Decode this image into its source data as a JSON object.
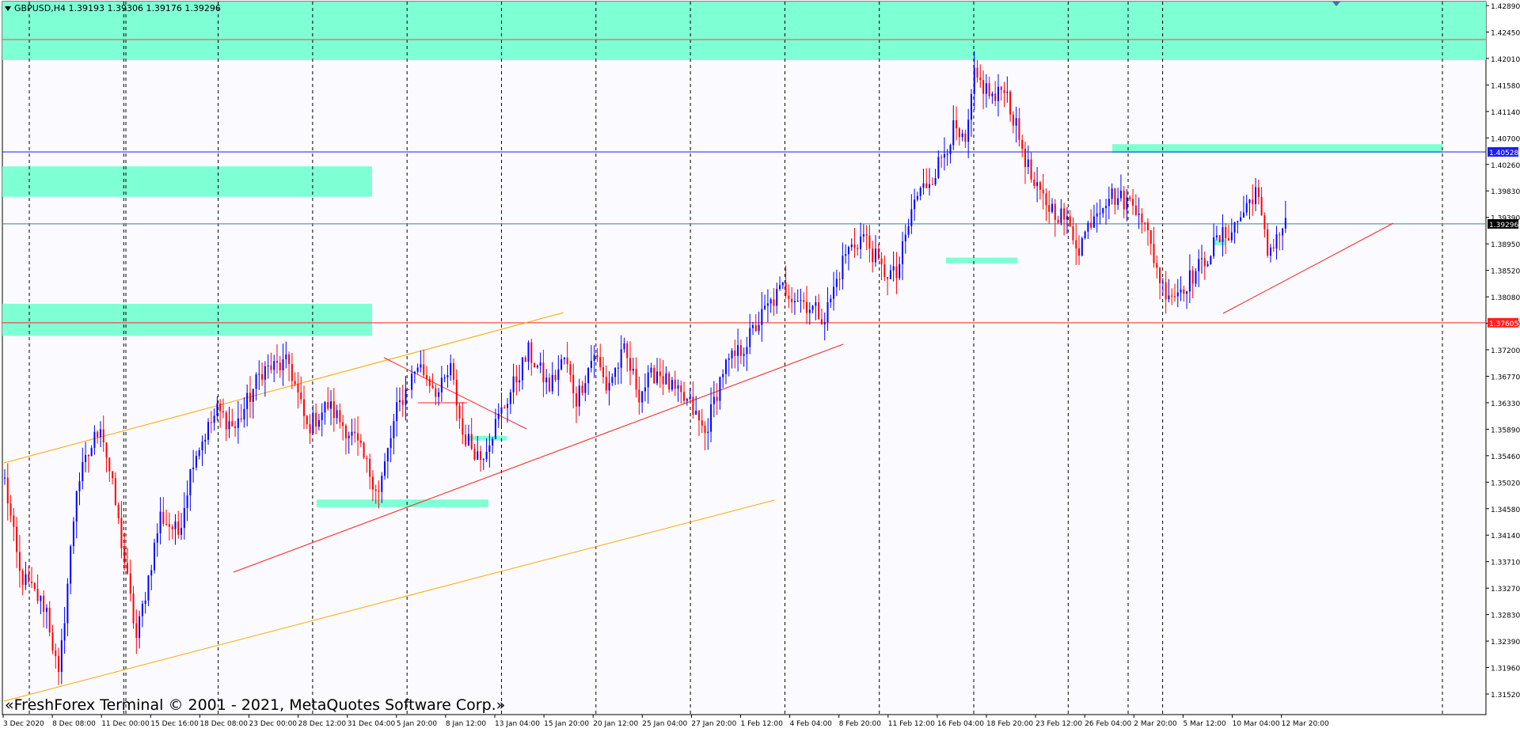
{
  "chart_data": {
    "type": "candlestick",
    "symbol_header": "GBPUSD,H4  1.39193 1.39306 1.39176 1.39296",
    "copyright": "«FreshForex Terminal © 2001 - 2021, MetaQuotes Software Corp.»",
    "ylim": [
      1.309,
      1.431
    ],
    "price_ticks": [
      "1.42890",
      "1.42450",
      "1.42010",
      "1.41580",
      "1.41140",
      "1.40700",
      "1.40260",
      "1.39830",
      "1.39390",
      "1.38950",
      "1.38520",
      "1.38080",
      "1.37640",
      "1.37200",
      "1.36770",
      "1.36330",
      "1.35890",
      "1.35460",
      "1.35020",
      "1.34580",
      "1.34140",
      "1.33710",
      "1.33270",
      "1.32830",
      "1.32390",
      "1.31960",
      "1.31520"
    ],
    "time_labels": [
      "3 Dec 2020",
      "8 Dec 08:00",
      "11 Dec 00:00",
      "15 Dec 16:00",
      "18 Dec 08:00",
      "23 Dec 00:00",
      "28 Dec 12:00",
      "31 Dec 04:00",
      "5 Jan 20:00",
      "8 Jan 12:00",
      "13 Jan 04:00",
      "15 Jan 20:00",
      "20 Jan 12:00",
      "25 Jan 04:00",
      "27 Jan 20:00",
      "1 Feb 12:00",
      "4 Feb 04:00",
      "8 Feb 20:00",
      "11 Feb 12:00",
      "16 Feb 04:00",
      "18 Feb 20:00",
      "23 Feb 12:00",
      "26 Feb 04:00",
      "2 Mar 20:00",
      "5 Mar 12:00",
      "10 Mar 04:00",
      "12 Mar 20:00"
    ],
    "price_tags": [
      {
        "label": "1.40528",
        "price": 1.40528,
        "bg": "#1a1aff",
        "line": "#1a1aff"
      },
      {
        "label": "1.39296",
        "price": 1.39296,
        "bg": "#000000",
        "line": "#2e8b8b"
      },
      {
        "label": "1.37605",
        "price": 1.37605,
        "bg": "#ff2020",
        "line": "#ff2020"
      }
    ],
    "key_points": [
      [
        0,
        1.349
      ],
      [
        5,
        1.333
      ],
      [
        14,
        1.327
      ],
      [
        18,
        1.315
      ],
      [
        24,
        1.348
      ],
      [
        32,
        1.359
      ],
      [
        37,
        1.345
      ],
      [
        44,
        1.322
      ],
      [
        52,
        1.343
      ],
      [
        58,
        1.34
      ],
      [
        63,
        1.353
      ],
      [
        71,
        1.361
      ],
      [
        77,
        1.358
      ],
      [
        86,
        1.368
      ],
      [
        95,
        1.369
      ],
      [
        101,
        1.358
      ],
      [
        108,
        1.362
      ],
      [
        117,
        1.356
      ],
      [
        125,
        1.347
      ],
      [
        131,
        1.361
      ],
      [
        138,
        1.369
      ],
      [
        145,
        1.364
      ],
      [
        149,
        1.368
      ],
      [
        153,
        1.357
      ],
      [
        159,
        1.353
      ],
      [
        167,
        1.362
      ],
      [
        175,
        1.371
      ],
      [
        182,
        1.365
      ],
      [
        187,
        1.37
      ],
      [
        191,
        1.363
      ],
      [
        197,
        1.371
      ],
      [
        201,
        1.365
      ],
      [
        207,
        1.371
      ],
      [
        212,
        1.364
      ],
      [
        218,
        1.368
      ],
      [
        224,
        1.364
      ],
      [
        229,
        1.362
      ],
      [
        234,
        1.357
      ],
      [
        240,
        1.368
      ],
      [
        247,
        1.372
      ],
      [
        254,
        1.378
      ],
      [
        260,
        1.382
      ],
      [
        266,
        1.38
      ],
      [
        274,
        1.377
      ],
      [
        281,
        1.388
      ],
      [
        287,
        1.391
      ],
      [
        293,
        1.385
      ],
      [
        298,
        1.384
      ],
      [
        304,
        1.397
      ],
      [
        311,
        1.402
      ],
      [
        317,
        1.409
      ],
      [
        321,
        1.406
      ],
      [
        324,
        1.418
      ],
      [
        328,
        1.416
      ],
      [
        331,
        1.414
      ],
      [
        334,
        1.417
      ],
      [
        337,
        1.411
      ],
      [
        340,
        1.406
      ],
      [
        344,
        1.399
      ],
      [
        349,
        1.396
      ],
      [
        354,
        1.394
      ],
      [
        359,
        1.389
      ],
      [
        364,
        1.395
      ],
      [
        369,
        1.398
      ],
      [
        374,
        1.397
      ],
      [
        379,
        1.396
      ],
      [
        383,
        1.389
      ],
      [
        387,
        1.382
      ],
      [
        391,
        1.381
      ],
      [
        395,
        1.383
      ],
      [
        400,
        1.386
      ],
      [
        405,
        1.39
      ],
      [
        410,
        1.392
      ],
      [
        414,
        1.395
      ],
      [
        418,
        1.399
      ],
      [
        422,
        1.388
      ],
      [
        425,
        1.391
      ],
      [
        428,
        1.3929
      ]
    ]
  }
}
